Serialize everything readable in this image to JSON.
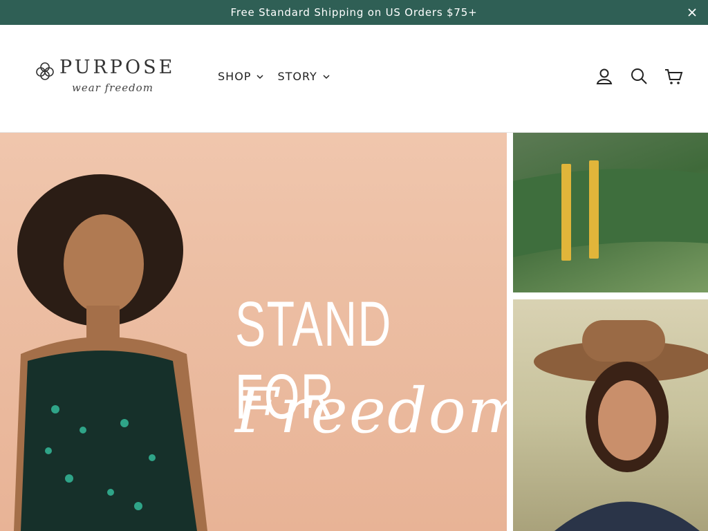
{
  "announcement": {
    "text": "Free Standard Shipping on US Orders $75+",
    "close_icon": "close-icon"
  },
  "logo": {
    "word": "PURPOSE",
    "tagline": "wear freedom",
    "icon": "flower-logo-icon"
  },
  "nav": {
    "items": [
      {
        "label": "SHOP"
      },
      {
        "label": "STORY"
      }
    ]
  },
  "header_icons": [
    "account-icon",
    "search-icon",
    "cart-icon"
  ],
  "hero": {
    "headline": "STAND FOR",
    "script": "Freedom"
  },
  "colors": {
    "banner": "#2f5f55",
    "text": "#222222",
    "hero_bg": "#ecbea3"
  }
}
